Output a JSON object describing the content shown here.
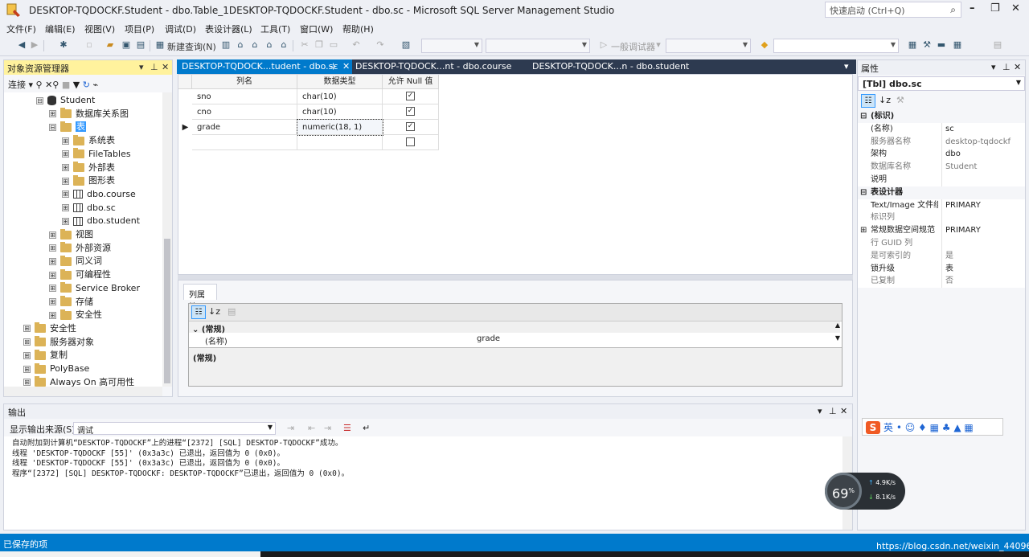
{
  "window": {
    "title": "DESKTOP-TQDOCKF.Student - dbo.Table_1DESKTOP-TQDOCKF.Student - dbo.sc - Microsoft SQL Server Management Studio",
    "quick_launch": "快速启动 (Ctrl+Q)"
  },
  "menu": [
    "文件(F)",
    "编辑(E)",
    "视图(V)",
    "项目(P)",
    "调试(D)",
    "表设计器(L)",
    "工具(T)",
    "窗口(W)",
    "帮助(H)"
  ],
  "toolbar": {
    "new_query": "新建查询(N)",
    "debugger": "一般调试器"
  },
  "object_explorer": {
    "title": "对象资源管理器",
    "connect": "连接",
    "nodes": [
      {
        "label": "Student",
        "kind": "db",
        "exp": "⊟",
        "depth": 0
      },
      {
        "label": "数据库关系图",
        "kind": "folder",
        "exp": "⊞",
        "depth": 1
      },
      {
        "label": "表",
        "kind": "folder",
        "exp": "⊟",
        "depth": 1,
        "selected": true
      },
      {
        "label": "系统表",
        "kind": "folder",
        "exp": "⊞",
        "depth": 2
      },
      {
        "label": "FileTables",
        "kind": "folder",
        "exp": "⊞",
        "depth": 2
      },
      {
        "label": "外部表",
        "kind": "folder",
        "exp": "⊞",
        "depth": 2
      },
      {
        "label": "图形表",
        "kind": "folder",
        "exp": "⊞",
        "depth": 2
      },
      {
        "label": "dbo.course",
        "kind": "table",
        "exp": "⊞",
        "depth": 2
      },
      {
        "label": "dbo.sc",
        "kind": "table",
        "exp": "⊞",
        "depth": 2
      },
      {
        "label": "dbo.student",
        "kind": "table",
        "exp": "⊞",
        "depth": 2
      },
      {
        "label": "视图",
        "kind": "folder",
        "exp": "⊞",
        "depth": 1
      },
      {
        "label": "外部资源",
        "kind": "folder",
        "exp": "⊞",
        "depth": 1
      },
      {
        "label": "同义词",
        "kind": "folder",
        "exp": "⊞",
        "depth": 1
      },
      {
        "label": "可编程性",
        "kind": "folder",
        "exp": "⊞",
        "depth": 1
      },
      {
        "label": "Service Broker",
        "kind": "folder",
        "exp": "⊞",
        "depth": 1
      },
      {
        "label": "存储",
        "kind": "folder",
        "exp": "⊞",
        "depth": 1
      },
      {
        "label": "安全性",
        "kind": "folder",
        "exp": "⊞",
        "depth": 1
      },
      {
        "label": "安全性",
        "kind": "folder",
        "exp": "⊞",
        "depth": -1
      },
      {
        "label": "服务器对象",
        "kind": "folder",
        "exp": "⊞",
        "depth": -1
      },
      {
        "label": "复制",
        "kind": "folder",
        "exp": "⊞",
        "depth": -1
      },
      {
        "label": "PolyBase",
        "kind": "folder",
        "exp": "⊞",
        "depth": -1
      },
      {
        "label": "Always On 高可用性",
        "kind": "folder",
        "exp": "⊞",
        "depth": -1
      }
    ]
  },
  "tabs": [
    {
      "label": "DESKTOP-TQDOCK...tudent - dbo.sc",
      "active": true,
      "pin": "⊹",
      "close": "✕"
    },
    {
      "label": "DESKTOP-TQDOCK...nt - dbo.course",
      "active": false
    },
    {
      "label": "DESKTOP-TQDOCK...n - dbo.student",
      "active": false
    }
  ],
  "designer": {
    "headers": [
      "列名",
      "数据类型",
      "允许 Null 值"
    ],
    "rows": [
      {
        "name": "sno",
        "type": "char(10)",
        "nullable": true,
        "current": false
      },
      {
        "name": "cno",
        "type": "char(10)",
        "nullable": true,
        "current": false
      },
      {
        "name": "grade",
        "type": "numeric(18, 1)",
        "nullable": true,
        "current": true
      },
      {
        "name": "",
        "type": "",
        "nullable": false,
        "current": false
      }
    ]
  },
  "column_properties": {
    "tab": "列属性",
    "category": "(常规)",
    "prop_name": "(名称)",
    "prop_value": "grade",
    "description": "(常规)"
  },
  "properties": {
    "title": "属性",
    "object": "[Tbl] dbo.sc",
    "rows": [
      {
        "cat": true,
        "k": "(标识)",
        "tog": "⊟"
      },
      {
        "k": "(名称)",
        "v": "sc"
      },
      {
        "k": "服务器名称",
        "v": "desktop-tqdockf",
        "gray": true
      },
      {
        "k": "架构",
        "v": "dbo"
      },
      {
        "k": "数据库名称",
        "v": "Student",
        "gray": true
      },
      {
        "k": "说明",
        "v": ""
      },
      {
        "cat": true,
        "k": "表设计器",
        "tog": "⊟"
      },
      {
        "k": "Text/Image 文件组",
        "v": "PRIMARY"
      },
      {
        "k": "标识列",
        "v": "",
        "gray": true
      },
      {
        "k": "常规数据空间规范",
        "v": "PRIMARY",
        "tog": "⊞"
      },
      {
        "k": "行 GUID 列",
        "v": "",
        "gray": true
      },
      {
        "k": "是可索引的",
        "v": "是",
        "gray": true
      },
      {
        "k": "锁升级",
        "v": "表"
      },
      {
        "k": "已复制",
        "v": "否",
        "gray": true
      }
    ]
  },
  "output": {
    "title": "输出",
    "source_label": "显示输出来源(S):",
    "source_value": "调试",
    "lines": [
      "自动附加到计算机“DESKTOP-TQDOCKF”上的进程“[2372] [SQL] DESKTOP-TQDOCKF”成功。",
      "线程 'DESKTOP-TQDOCKF [55]' (0x3a3c) 已退出，返回值为 0 (0x0)。",
      "线程 'DESKTOP-TQDOCKF [55]' (0x3a3c) 已退出，返回值为 0 (0x0)。",
      "程序“[2372] [SQL] DESKTOP-TQDOCKF: DESKTOP-TQDOCKF”已退出，返回值为 0 (0x0)。"
    ]
  },
  "status": "已保存的项",
  "watermark": "https://blog.csdn.net/weixin_44096577",
  "ime": {
    "label": "英",
    "icons": "• ☺ ♦ ▦ ♣ ▲ ▦"
  },
  "perf": {
    "percent": "69",
    "unit": "%",
    "up": "4.9",
    "down": "8.1",
    "rate_unit": "K/s"
  },
  "colors": {
    "accent": "#007acc",
    "selection": "#3399ff",
    "explorer_header": "#fff29d"
  }
}
